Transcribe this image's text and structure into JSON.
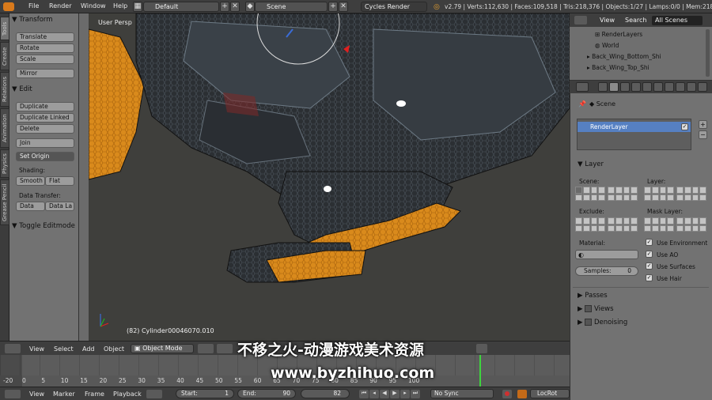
{
  "menu": {
    "file": "File",
    "render": "Render",
    "window": "Window",
    "help": "Help"
  },
  "screen_layout": "Default",
  "scene_name": "Scene",
  "render_engine": "Cycles Render",
  "stats": "v2.79 | Verts:112,630 | Faces:109,518 | Tris:218,376 | Objects:1/27 | Lamps:0/0 | Mem:2184",
  "vtabs": [
    "Tools",
    "Create",
    "Relations",
    "Animation",
    "Physics",
    "Grease Pencil"
  ],
  "tools": {
    "transform": "Transform",
    "translate": "Translate",
    "rotate": "Rotate",
    "scale": "Scale",
    "mirror": "Mirror",
    "edit": "Edit",
    "duplicate": "Duplicate",
    "duplicate_linked": "Duplicate Linked",
    "delete": "Delete",
    "join": "Join",
    "set_origin": "Set Origin",
    "shading": "Shading:",
    "smooth": "Smooth",
    "flat": "Flat",
    "data_transfer": "Data Transfer:",
    "data": "Data",
    "data_la": "Data La",
    "toggle_editmode": "Toggle Editmode"
  },
  "viewport": {
    "view_label": "User Persp",
    "object_label": "(82) Cylinder00046070.010"
  },
  "outliner": {
    "view": "View",
    "search": "Search",
    "all_scenes": "All Scenes",
    "rows": [
      "RenderLayers",
      "World",
      "Back_Wing_Bottom_Shi",
      "Back_Wing_Top_Shi"
    ]
  },
  "properties": {
    "scene_label": "Scene",
    "render_layer": "RenderLayer",
    "layer": "Layer",
    "scene_sub": "Scene:",
    "layer_sub": "Layer:",
    "exclude": "Exclude:",
    "mask_layer": "Mask Layer:",
    "material": "Material:",
    "samples_label": "Samples:",
    "samples_value": "0",
    "use_environment": "Use Environment",
    "use_ao": "Use AO",
    "use_surfaces": "Use Surfaces",
    "use_hair": "Use Hair",
    "passes": "Passes",
    "views": "Views",
    "denoising": "Denoising"
  },
  "view_header": {
    "view": "View",
    "select": "Select",
    "add": "Add",
    "object": "Object",
    "mode": "Object Mode"
  },
  "timeline": {
    "ticks": [
      "-20",
      "0",
      "5",
      "10",
      "15",
      "20",
      "25",
      "30",
      "35",
      "40",
      "45",
      "50",
      "55",
      "60",
      "65",
      "70",
      "75",
      "80",
      "85",
      "90",
      "95",
      "100"
    ],
    "current_frame": 82
  },
  "timeline_header": {
    "view": "View",
    "marker": "Marker",
    "frame": "Frame",
    "playback": "Playback",
    "start_label": "Start:",
    "start_value": "1",
    "end_label": "End:",
    "end_value": "90",
    "current": "82",
    "sync": "No Sync",
    "locrot": "LocRot"
  },
  "watermark": {
    "line1": "不移之火-动漫游戏美术资源",
    "line2": "www.byzhihuo.com"
  }
}
